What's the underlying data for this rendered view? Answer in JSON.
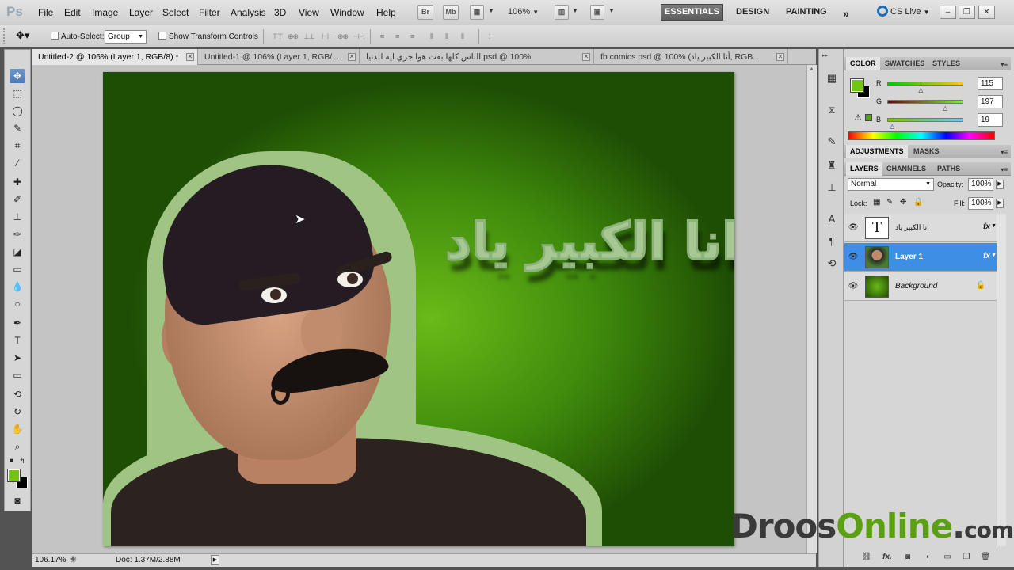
{
  "app": {
    "logo": "Ps",
    "menu": [
      "File",
      "Edit",
      "Image",
      "Layer",
      "Select",
      "Filter",
      "Analysis",
      "3D",
      "View",
      "Window",
      "Help"
    ],
    "bridge_label": "Br",
    "minibridge_label": "Mb",
    "zoom": "106%",
    "workspaces": {
      "active": "ESSENTIALS",
      "others": [
        "DESIGN",
        "PAINTING"
      ]
    },
    "cs_live": "CS Live"
  },
  "options": {
    "auto_select_label": "Auto-Select:",
    "auto_select_value": "Group",
    "show_transform_label": "Show Transform Controls"
  },
  "tabs": [
    {
      "label": "Untitled-2 @ 106% (Layer 1, RGB/8) *",
      "active": true
    },
    {
      "label": "Untitled-1 @ 106% (Layer 1, RGB/...",
      "active": false
    },
    {
      "label": "الناس كلها بقت هوا جري ايه للدنيا.psd @ 100%",
      "active": false
    },
    {
      "label": "fb comics.psd @ 100% (أنا الكبير ياد, RGB...",
      "active": false
    }
  ],
  "canvas": {
    "title_text": "انا الكبير ياد",
    "fg_color": "#73c513",
    "bg_color": "#000000"
  },
  "watermark": {
    "part1": "Droos",
    "part2": "Online",
    "dot": ".",
    "part3": "com"
  },
  "status": {
    "zoom": "106.17%",
    "doc": "Doc: 1.37M/2.88M"
  },
  "color_panel": {
    "tabs": [
      "COLOR",
      "SWATCHES",
      "STYLES"
    ],
    "r_label": "R",
    "r": 115,
    "g_label": "G",
    "g": 197,
    "b_label": "B",
    "b": 19
  },
  "adjust_panel": {
    "tabs": [
      "ADJUSTMENTS",
      "MASKS"
    ]
  },
  "layers_panel": {
    "tabs": [
      "LAYERS",
      "CHANNELS",
      "PATHS"
    ],
    "blend_mode": "Normal",
    "opacity_label": "Opacity:",
    "opacity": "100%",
    "lock_label": "Lock:",
    "fill_label": "Fill:",
    "fill": "100%",
    "layers": [
      {
        "name": "انا الكبير ياد",
        "thumb": "T",
        "fx": "fx",
        "selected": false
      },
      {
        "name": "Layer 1",
        "fx": "fx",
        "selected": true
      },
      {
        "name": "Background",
        "selected": false
      }
    ]
  }
}
